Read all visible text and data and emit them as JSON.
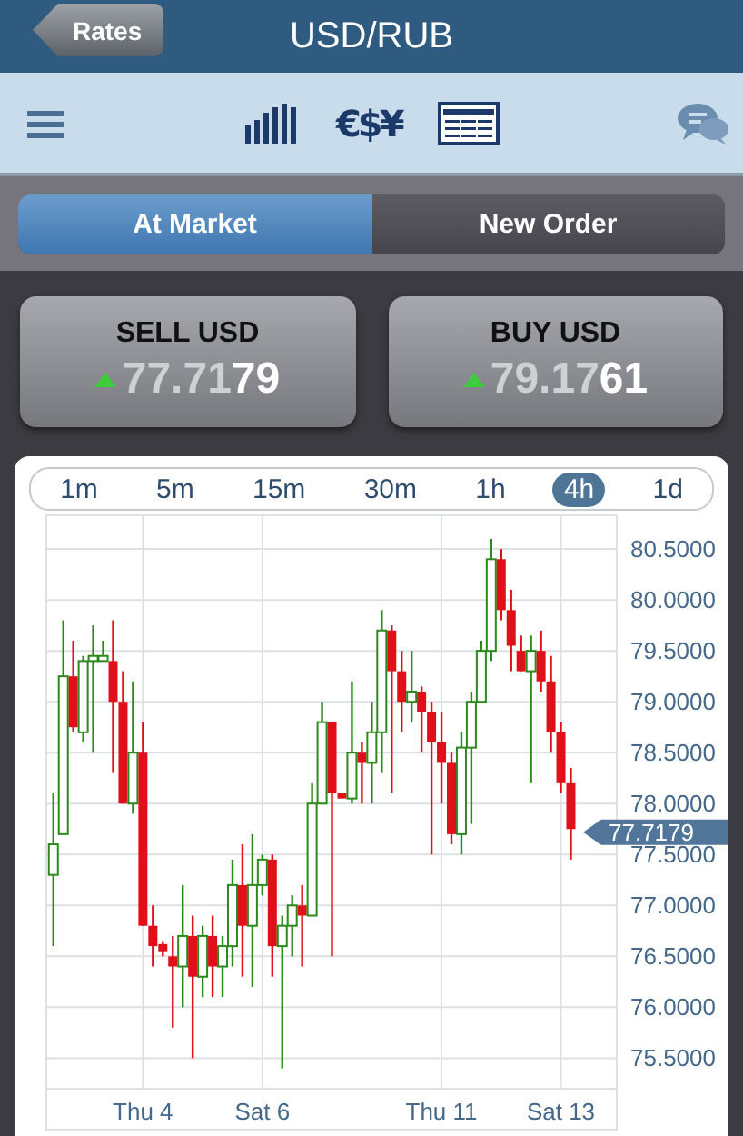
{
  "header": {
    "back_button": "Rates",
    "title": "USD/RUB"
  },
  "toolbar": {
    "currency_button": "€$¥"
  },
  "order_tabs": [
    {
      "label": "At Market",
      "selected": true
    },
    {
      "label": "New Order",
      "selected": false
    }
  ],
  "quotes": [
    {
      "label": "SELL USD",
      "rising": true,
      "price_main": "77.71",
      "price_pips": "79"
    },
    {
      "label": "BUY USD",
      "rising": true,
      "price_main": "79.17",
      "price_pips": "61"
    }
  ],
  "timeframes": [
    {
      "label": "1m",
      "selected": false
    },
    {
      "label": "5m",
      "selected": false
    },
    {
      "label": "15m",
      "selected": false
    },
    {
      "label": "30m",
      "selected": false
    },
    {
      "label": "1h",
      "selected": false
    },
    {
      "label": "4h",
      "selected": true
    },
    {
      "label": "1d",
      "selected": false
    }
  ],
  "chart": {
    "current_price": "77.7179",
    "chart_data": {
      "type": "candlestick",
      "categories": [
        null,
        null,
        null,
        null,
        null,
        null,
        null,
        null,
        null,
        "Thu 4",
        null,
        null,
        null,
        null,
        null,
        null,
        null,
        null,
        null,
        null,
        null,
        "Sat 6",
        null,
        null,
        null,
        null,
        null,
        null,
        null,
        null,
        null,
        null,
        null,
        null,
        null,
        null,
        null,
        null,
        null,
        "Thu 11",
        null,
        null,
        null,
        null,
        null,
        null,
        null,
        null,
        null,
        null,
        null,
        "Sat 13",
        null
      ],
      "ohlc": [
        [
          77.3,
          78.1,
          76.6,
          77.6
        ],
        [
          77.7,
          79.8,
          77.7,
          79.25
        ],
        [
          79.25,
          79.6,
          78.7,
          78.75
        ],
        [
          78.7,
          79.45,
          78.6,
          79.4
        ],
        [
          79.4,
          79.75,
          78.5,
          79.45
        ],
        [
          79.4,
          79.6,
          79.4,
          79.45
        ],
        [
          79.4,
          79.8,
          78.3,
          79.0
        ],
        [
          79.0,
          79.3,
          78.0,
          78.0
        ],
        [
          78.0,
          79.2,
          77.9,
          78.5
        ],
        [
          78.5,
          78.8,
          76.8,
          76.8
        ],
        [
          76.8,
          77.0,
          76.4,
          76.6
        ],
        [
          76.62,
          76.65,
          76.5,
          76.55
        ],
        [
          76.5,
          76.7,
          75.8,
          76.4
        ],
        [
          76.4,
          77.2,
          76.0,
          76.7
        ],
        [
          76.7,
          76.9,
          75.5,
          76.3
        ],
        [
          76.3,
          76.8,
          76.1,
          76.7
        ],
        [
          76.7,
          76.9,
          76.1,
          76.4
        ],
        [
          76.4,
          76.7,
          76.1,
          76.6
        ],
        [
          76.6,
          77.45,
          76.4,
          77.2
        ],
        [
          77.2,
          77.6,
          76.3,
          76.8
        ],
        [
          76.8,
          77.7,
          76.2,
          77.2
        ],
        [
          77.2,
          77.5,
          77.1,
          77.45
        ],
        [
          77.45,
          77.5,
          76.3,
          76.6
        ],
        [
          76.6,
          76.9,
          75.4,
          76.8
        ],
        [
          76.8,
          77.1,
          76.5,
          77.0
        ],
        [
          77.0,
          77.2,
          76.4,
          76.9
        ],
        [
          76.9,
          78.2,
          76.9,
          78.0
        ],
        [
          78.0,
          79.0,
          78.0,
          78.8
        ],
        [
          78.8,
          78.8,
          76.5,
          78.1
        ],
        [
          78.1,
          78.1,
          78.05,
          78.05
        ],
        [
          78.05,
          79.2,
          78.0,
          78.5
        ],
        [
          78.5,
          78.6,
          78.0,
          78.4
        ],
        [
          78.4,
          79.0,
          78.0,
          78.7
        ],
        [
          78.7,
          79.9,
          78.3,
          79.7
        ],
        [
          79.7,
          79.75,
          78.1,
          79.3
        ],
        [
          79.3,
          79.5,
          78.7,
          79.0
        ],
        [
          79.0,
          79.5,
          78.8,
          79.1
        ],
        [
          79.1,
          79.15,
          78.5,
          78.9
        ],
        [
          78.9,
          79.0,
          77.5,
          78.6
        ],
        [
          78.6,
          78.9,
          78.0,
          78.4
        ],
        [
          78.4,
          78.5,
          77.6,
          77.7
        ],
        [
          77.7,
          78.7,
          77.5,
          78.55
        ],
        [
          78.55,
          79.1,
          77.8,
          79.0
        ],
        [
          79.0,
          79.6,
          79.0,
          79.5
        ],
        [
          79.5,
          80.6,
          79.4,
          80.4
        ],
        [
          80.4,
          80.5,
          79.8,
          79.9
        ],
        [
          79.9,
          80.1,
          79.3,
          79.55
        ],
        [
          79.5,
          79.65,
          79.3,
          79.3
        ],
        [
          79.3,
          79.65,
          78.2,
          79.5
        ],
        [
          79.5,
          79.7,
          79.1,
          79.2
        ],
        [
          79.2,
          79.45,
          78.5,
          78.7
        ],
        [
          78.7,
          78.8,
          78.1,
          78.2
        ],
        [
          78.2,
          78.35,
          77.45,
          77.75
        ]
      ],
      "ylim": [
        75.2,
        80.84
      ],
      "grid": true,
      "yticks": [
        {
          "value": 80.5,
          "label": "80.5000"
        },
        {
          "value": 80,
          "label": "80.0000"
        },
        {
          "value": 79.5,
          "label": "79.5000"
        },
        {
          "value": 79,
          "label": "79.0000"
        },
        {
          "value": 78.5,
          "label": "78.5000"
        },
        {
          "value": 78,
          "label": "78.0000"
        },
        {
          "value": 77.5,
          "label": "77.5000"
        },
        {
          "value": 77,
          "label": "77.0000"
        },
        {
          "value": 76.5,
          "label": "76.5000"
        },
        {
          "value": 76,
          "label": "76.0000"
        },
        {
          "value": 75.5,
          "label": "75.5000"
        }
      ]
    }
  }
}
